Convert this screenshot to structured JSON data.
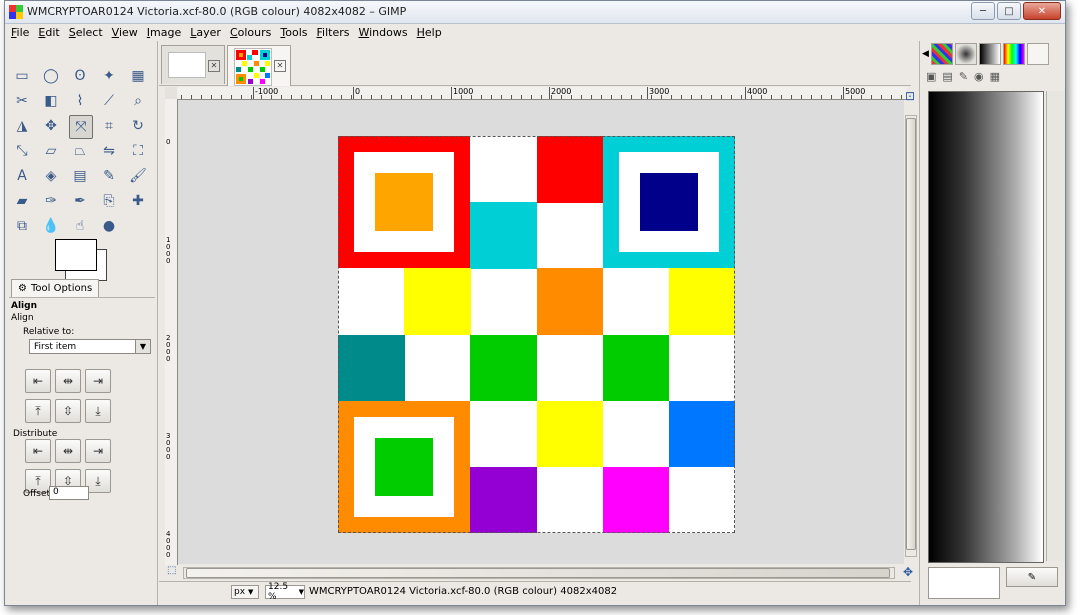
{
  "window": {
    "title": "WMCRYPTOAR0124 Victoria.xcf-80.0 (RGB colour) 4082x4082 – GIMP",
    "buttons": {
      "minimize": "─",
      "maximize": "□",
      "close": "✕"
    }
  },
  "menu": [
    "File",
    "Edit",
    "Select",
    "View",
    "Image",
    "Layer",
    "Colours",
    "Tools",
    "Filters",
    "Windows",
    "Help"
  ],
  "toolbox": {
    "tools": [
      {
        "name": "rect-select-icon",
        "glyph": "▭"
      },
      {
        "name": "ellipse-select-icon",
        "glyph": "◯"
      },
      {
        "name": "free-select-icon",
        "glyph": "ʘ"
      },
      {
        "name": "fuzzy-select-icon",
        "glyph": "✦"
      },
      {
        "name": "select-by-color-icon",
        "glyph": "▦"
      },
      {
        "name": "scissors-icon",
        "glyph": "✂"
      },
      {
        "name": "foreground-select-icon",
        "glyph": "◧"
      },
      {
        "name": "paths-icon",
        "glyph": "⌇"
      },
      {
        "name": "color-picker-icon",
        "glyph": "⟋"
      },
      {
        "name": "zoom-icon",
        "glyph": "⌕"
      },
      {
        "name": "measure-icon",
        "glyph": "◮"
      },
      {
        "name": "move-icon",
        "glyph": "✥"
      },
      {
        "name": "align-icon",
        "glyph": "⤧"
      },
      {
        "name": "crop-icon",
        "glyph": "⌗"
      },
      {
        "name": "rotate-icon",
        "glyph": "↻"
      },
      {
        "name": "scale-icon",
        "glyph": "⤡"
      },
      {
        "name": "shear-icon",
        "glyph": "▱"
      },
      {
        "name": "perspective-icon",
        "glyph": "⏢"
      },
      {
        "name": "flip-icon",
        "glyph": "⇋"
      },
      {
        "name": "cage-icon",
        "glyph": "⛶"
      },
      {
        "name": "text-icon",
        "glyph": "A"
      },
      {
        "name": "bucket-fill-icon",
        "glyph": "◈"
      },
      {
        "name": "blend-icon",
        "glyph": "▤"
      },
      {
        "name": "pencil-icon",
        "glyph": "✎"
      },
      {
        "name": "paintbrush-icon",
        "glyph": "🖌"
      },
      {
        "name": "eraser-icon",
        "glyph": "▰"
      },
      {
        "name": "airbrush-icon",
        "glyph": "✑"
      },
      {
        "name": "ink-icon",
        "glyph": "✒"
      },
      {
        "name": "clone-icon",
        "glyph": "⎘"
      },
      {
        "name": "heal-icon",
        "glyph": "✚"
      },
      {
        "name": "perspective-clone-icon",
        "glyph": "⧉"
      },
      {
        "name": "blur-icon",
        "glyph": "💧"
      },
      {
        "name": "smudge-icon",
        "glyph": "☝"
      },
      {
        "name": "dodge-burn-icon",
        "glyph": "●"
      }
    ],
    "active_index": 12
  },
  "tool_options": {
    "tab_label": "Tool Options",
    "heading": "Align",
    "subheading": "Align",
    "relative_to_label": "Relative to:",
    "relative_to_value": "First item",
    "distribute_label": "Distribute",
    "offset_label": "Offset:",
    "offset_value": "0"
  },
  "canvas": {
    "ruler_h_labels": [
      "-1000",
      "0",
      "1000",
      "2000",
      "3000",
      "4000",
      "5000"
    ],
    "ruler_v_labels": [
      "0",
      "1000",
      "2000",
      "3000",
      "4000"
    ]
  },
  "artwork_colors": {
    "red": "#ff0000",
    "cyan": "#00cfd6",
    "orange_light": "#ffa500",
    "navy": "#00008b",
    "yellow": "#ffff00",
    "orange": "#ff8c00",
    "teal": "#008b8b",
    "green": "#00cc00",
    "blue": "#0077ff",
    "purple": "#9400d3",
    "magenta": "#ff00ff",
    "white": "#ffffff"
  },
  "status": {
    "unit": "px",
    "zoom": "12.5 %",
    "text": "WMCRYPTOAR0124 Victoria.xcf-80.0 (RGB colour) 4082x4082"
  }
}
